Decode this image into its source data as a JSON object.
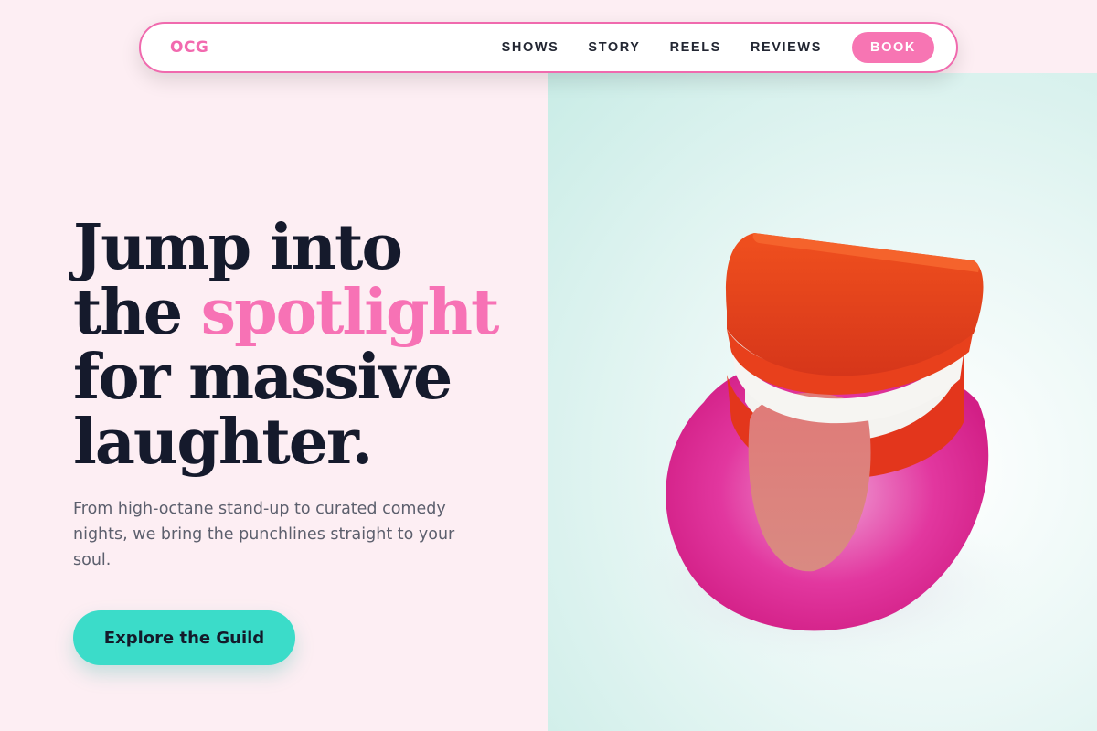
{
  "brand": {
    "logo_text": "OCG"
  },
  "nav": {
    "links": [
      "SHOWS",
      "STORY",
      "REELS",
      "REVIEWS"
    ],
    "book_label": "BOOK"
  },
  "hero": {
    "title_line1": "Jump into",
    "title_line2_prefix": "the ",
    "title_line2_accent": "spotlight",
    "title_line3": "for massive",
    "title_line4": "laughter.",
    "subtitle": "From high-octane stand-up to curated comedy nights, we bring the punchlines straight to your soul.",
    "cta_label": "Explore the Guild"
  },
  "colors": {
    "accent_pink": "#f772b5",
    "cta_teal": "#3bdcc9",
    "page_bg": "#fdeef3",
    "heading": "#151a2c"
  },
  "icons": {
    "hero_image": "wind-up-chattering-teeth-photo"
  }
}
